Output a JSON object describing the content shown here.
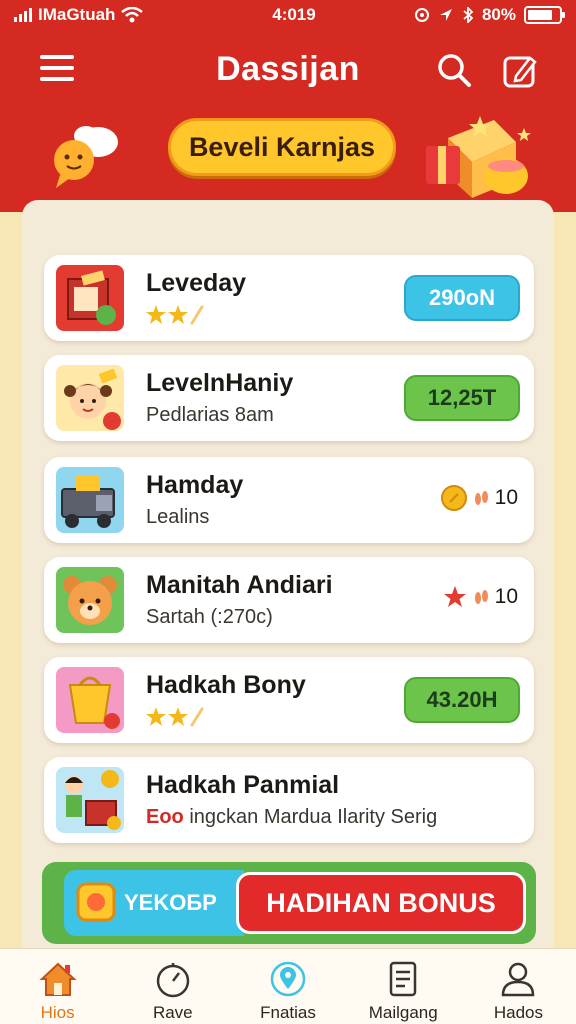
{
  "status_bar": {
    "carrier": "IMaGtuah",
    "time": "4:019",
    "battery": "80%"
  },
  "header": {
    "title": "Dassijan",
    "banner": "Beveli Karnjas"
  },
  "list": [
    {
      "title": "Leveday",
      "subtitle": "",
      "stars": 2,
      "value": "290oN",
      "value_style": "blue"
    },
    {
      "title": "LevelnHaniy",
      "subtitle": "Pedlarias 8am",
      "value": "12,25T",
      "value_style": "green"
    },
    {
      "title": "Hamday",
      "subtitle": "Lealins",
      "reward": "10",
      "reward_icon": "coin-icon"
    },
    {
      "title": "Manitah Andiari",
      "subtitle": "Sartah (:270c)",
      "reward": "10",
      "reward_icon": "star-icon"
    },
    {
      "title": "Hadkah Bony",
      "subtitle": "",
      "stars": 2,
      "value": "43.20H",
      "value_style": "green"
    },
    {
      "title": "Hadkah Panmial",
      "subtitle_accent": "Eoo",
      "subtitle": "ingckan Mardua Ilarity Serig"
    }
  ],
  "bottom_banner": {
    "left_label": "YEKOБP",
    "button_label": "HADIHAN  BONUS"
  },
  "tabs": [
    {
      "label": "Hios",
      "icon": "home-icon",
      "active": true
    },
    {
      "label": "Rave",
      "icon": "timer-icon",
      "active": false
    },
    {
      "label": "Fnatias",
      "icon": "location-icon",
      "active": false
    },
    {
      "label": "Mailgang",
      "icon": "document-icon",
      "active": false
    },
    {
      "label": "Hados",
      "icon": "profile-icon",
      "active": false
    }
  ],
  "colors": {
    "primary_red": "#d42a22",
    "accent_yellow": "#ffc72b",
    "badge_blue": "#3cc3e6",
    "badge_green": "#6cc44a",
    "tab_active": "#e0761a"
  }
}
